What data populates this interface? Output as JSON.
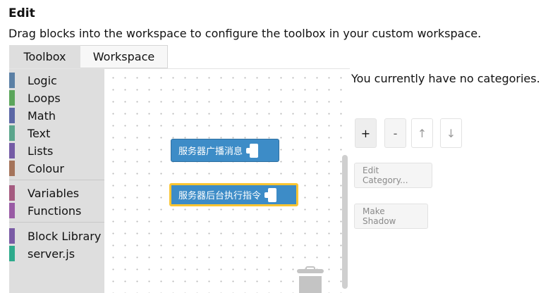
{
  "header": {
    "title": "Edit",
    "subtitle": "Drag blocks into the workspace to configure the toolbox in your custom workspace."
  },
  "tabs": [
    {
      "label": "Toolbox",
      "active": true
    },
    {
      "label": "Workspace",
      "active": false
    }
  ],
  "toolbox": {
    "items": [
      {
        "label": "Logic",
        "color": "#5b80a5"
      },
      {
        "label": "Loops",
        "color": "#5ba55b"
      },
      {
        "label": "Math",
        "color": "#5b67a5"
      },
      {
        "label": "Text",
        "color": "#5ba58c"
      },
      {
        "label": "Lists",
        "color": "#745ba5"
      },
      {
        "label": "Colour",
        "color": "#a5745b"
      },
      {
        "label": "Variables",
        "color": "#a55b80"
      },
      {
        "label": "Functions",
        "color": "#995ba5"
      },
      {
        "label": "Block Library",
        "color": "#7a5ba5"
      },
      {
        "label": "server.js",
        "color": "#2eaa8c"
      }
    ]
  },
  "workspace": {
    "blocks": [
      {
        "label": "服务器广播消息",
        "color": "#3d8cc7",
        "selected": false
      },
      {
        "label": "服务器后台执行指令",
        "color": "#3d8cc7",
        "selected": true
      }
    ],
    "trash_icon": "trash-can-icon"
  },
  "categories_panel": {
    "empty_message": "You currently have no categories.",
    "add_label": "+",
    "remove_label": "-",
    "up_label": "↑",
    "down_label": "↓",
    "edit_category_label": "Edit Category...",
    "make_shadow_label": "Make Shadow"
  }
}
